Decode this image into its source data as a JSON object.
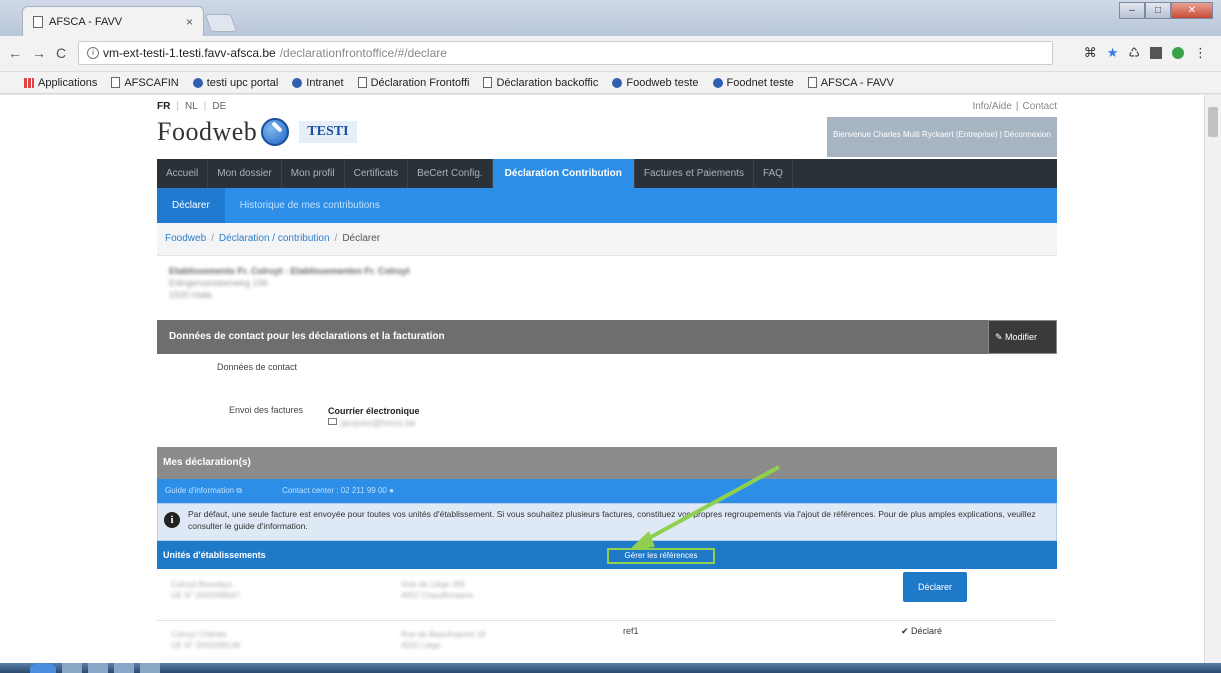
{
  "browser": {
    "tab_title": "AFSCA - FAVV",
    "tab_close": "×",
    "url_host": "vm-ext-testi-1.testi.favv-afsca.be",
    "url_path": "/declarationfrontoffice/#/declare",
    "bookmarks": [
      {
        "label": "Applications",
        "icon": "apps-icon"
      },
      {
        "label": "AFSCAFIN",
        "icon": "page-icon"
      },
      {
        "label": "testi upc portal",
        "icon": "globe-icon"
      },
      {
        "label": "Intranet",
        "icon": "globe-icon"
      },
      {
        "label": "Déclaration Frontoffi",
        "icon": "page-icon"
      },
      {
        "label": "Déclaration backoffic",
        "icon": "page-icon"
      },
      {
        "label": "Foodweb teste",
        "icon": "globe-icon"
      },
      {
        "label": "Foodnet teste",
        "icon": "globe-icon"
      },
      {
        "label": "AFSCA - FAVV",
        "icon": "page-icon"
      }
    ]
  },
  "site": {
    "langs": [
      "FR",
      "NL",
      "DE"
    ],
    "toplinks": {
      "help": "Info/Aide",
      "contact": "Contact"
    },
    "logo_name": "Foodweb",
    "logo_badge": "TESTI",
    "welcome": "Bienvenue Charles Multi Ryckaert (Entreprise) | Déconnexion",
    "nav": [
      "Accueil",
      "Mon dossier",
      "Mon profil",
      "Certificats",
      "BeCert Config.",
      "Déclaration Contribution",
      "Factures et Paiements",
      "FAQ"
    ],
    "subnav": [
      "Déclarer",
      "Historique de mes contributions"
    ],
    "breadcrumb": [
      "Foodweb",
      "Déclaration / contribution",
      "Déclarer"
    ],
    "breadcrumb_sep": "/"
  },
  "company": {
    "name": "Etablissements Fr. Colruyt - Etablissementen Fr. Colruyt",
    "street": "Edingensesteenweg 196",
    "city": "1500 Halle"
  },
  "contact_section": {
    "title": "Données de contact pour les déclarations et la facturation",
    "modify": "✎ Modifier",
    "contact_label": "Données de contact",
    "invoice_label": "Envoi des factures",
    "invoice_value": "Courrier électronique",
    "invoice_email": "jacques@hmco.be"
  },
  "declarations": {
    "title": "Mes déclaration(s)",
    "guide": "Guide d'information ⧉",
    "contact_center": "Contact center : 02 211 99 00 ●",
    "info": "Par défaut, une seule facture est envoyée pour toutes vos unités d'établissement. Si vous souhaitez plusieurs factures, constituez vos propres regroupements via l'ajout de références. Pour de plus amples explications, veuillez consulter le guide d'information.",
    "info_icon": "i",
    "units_label": "Unités d'établissements",
    "manage_refs": "Gérer les références",
    "rows": [
      {
        "name": "Colruyt Beaufays",
        "ue": "UE N° 2000288047",
        "addr1": "Voie de Liège 265",
        "addr2": "4052 Chaudfontaine",
        "ref": "",
        "action": "Déclarer",
        "status": ""
      },
      {
        "name": "Colruyt Chênée",
        "ue": "UE N° 2000288148",
        "addr1": "Rue de Beaufraipont 16",
        "addr2": "4032 Liège",
        "ref": "ref1",
        "action": "",
        "status": "✔ Déclaré"
      }
    ]
  },
  "colors": {
    "accent": "#2c8ee6",
    "nav_dark": "#2b3139",
    "highlight": "#8fd14f"
  }
}
